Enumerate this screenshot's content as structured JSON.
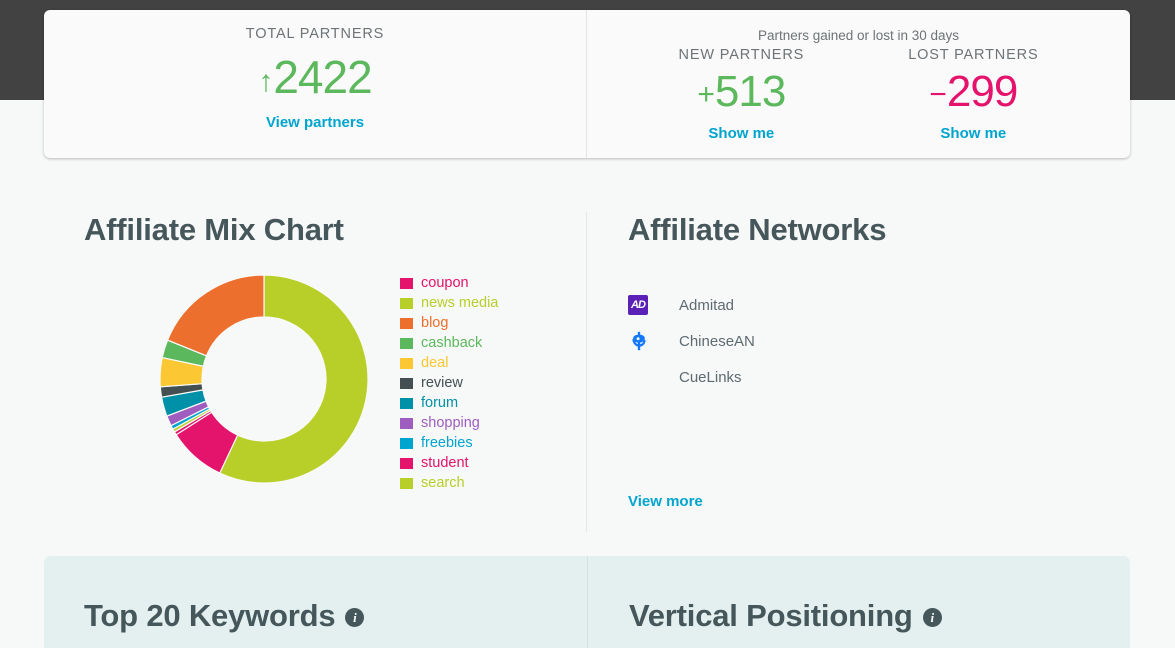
{
  "kpi": {
    "total_label": "TOTAL PARTNERS",
    "total_sign": "↑",
    "total_value": "2422",
    "total_link": "View partners",
    "delta_caption": "Partners gained or lost in 30 days",
    "new_label": "NEW PARTNERS",
    "new_sign": "+",
    "new_value": "513",
    "new_link": "Show me",
    "lost_label": "LOST PARTNERS",
    "lost_sign": "−",
    "lost_value": "299",
    "lost_link": "Show me"
  },
  "mix": {
    "title": "Affiliate Mix Chart"
  },
  "networks": {
    "title": "Affiliate Networks",
    "items": [
      {
        "name": "Admitad",
        "icon": "admitad-logo-icon",
        "icon_text": "AD"
      },
      {
        "name": "ChineseAN",
        "icon": "chinesean-logo-icon",
        "icon_text": ""
      },
      {
        "name": "CueLinks",
        "icon": "",
        "icon_text": ""
      }
    ],
    "view_more": "View more"
  },
  "bottom": {
    "keywords_title": "Top 20 Keywords",
    "keywords_info": "i",
    "vertical_title": "Vertical Positioning",
    "vertical_info": "i"
  },
  "colors": {
    "coupon": "#e4136b",
    "news_media": "#b9cf29",
    "blog": "#ed6f2d",
    "cashback": "#5cb85c",
    "deal": "#fbc732",
    "review": "#434f51",
    "forum": "#0090a8",
    "shopping": "#a05dc0",
    "freebies": "#00a5cf",
    "student": "#e4136b",
    "search": "#b9cf29",
    "accent_link": "#00a5cf",
    "positive": "#5cb85c",
    "negative": "#e4136b",
    "heading": "#46575b"
  },
  "chart_data": {
    "type": "pie",
    "title": "Affiliate Mix Chart",
    "donut": true,
    "categories": [
      "news media",
      "coupon",
      "student",
      "search",
      "freebies",
      "shopping",
      "forum",
      "review",
      "deal",
      "cashback",
      "blog"
    ],
    "values": [
      57.0,
      9.0,
      0.5,
      0.5,
      0.6,
      1.6,
      3.0,
      1.6,
      4.5,
      2.8,
      18.9
    ],
    "colors": [
      "#b9cf29",
      "#e4136b",
      "#e4136b",
      "#b9cf29",
      "#00a5cf",
      "#a05dc0",
      "#0090a8",
      "#434f51",
      "#fbc732",
      "#5cb85c",
      "#ed6f2d"
    ],
    "legend_order": [
      "coupon",
      "news media",
      "blog",
      "cashback",
      "deal",
      "review",
      "forum",
      "shopping",
      "freebies",
      "student",
      "search"
    ],
    "legend_colors": [
      "#e4136b",
      "#b9cf29",
      "#ed6f2d",
      "#5cb85c",
      "#fbc732",
      "#434f51",
      "#0090a8",
      "#a05dc0",
      "#00a5cf",
      "#e4136b",
      "#b9cf29"
    ],
    "legend_position": "right",
    "start_angle": 0
  }
}
